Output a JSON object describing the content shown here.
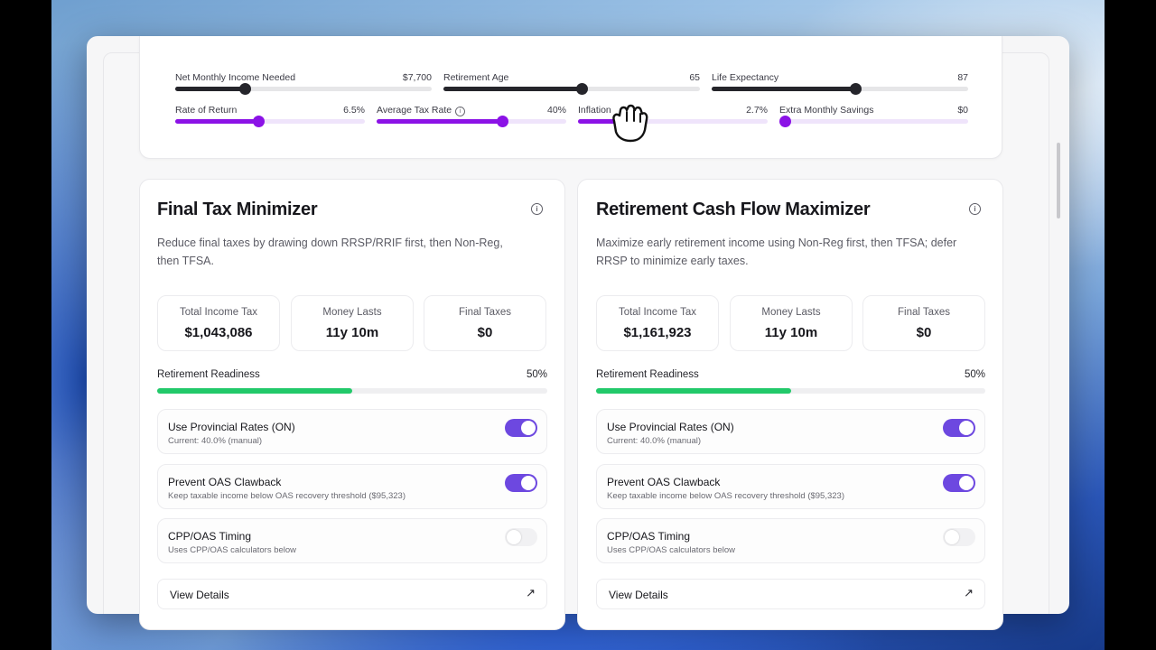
{
  "sliders": {
    "net_income": {
      "label": "Net Monthly Income Needed",
      "value": "$7,700",
      "fraction": 0.27
    },
    "retirement_age": {
      "label": "Retirement Age",
      "value": "65",
      "fraction": 0.54
    },
    "life_expectancy": {
      "label": "Life Expectancy",
      "value": "87",
      "fraction": 0.56
    },
    "rate_of_return": {
      "label": "Rate of Return",
      "value": "6.5%",
      "fraction": 0.44
    },
    "average_tax_rate": {
      "label": "Average Tax Rate",
      "value": "40%",
      "fraction": 0.66
    },
    "inflation": {
      "label": "Inflation",
      "value": "2.7%",
      "fraction": 0.27
    },
    "extra_savings": {
      "label": "Extra Monthly Savings",
      "value": "$0",
      "fraction": 0.0
    }
  },
  "cards": [
    {
      "title": "Final Tax Minimizer",
      "description": "Reduce final taxes by drawing down RRSP/RRIF first, then Non-Reg, then TFSA.",
      "stats": [
        {
          "label": "Total Income Tax",
          "value": "$1,043,086"
        },
        {
          "label": "Money Lasts",
          "value": "11y 10m"
        },
        {
          "label": "Final Taxes",
          "value": "$0"
        }
      ],
      "readiness": {
        "label": "Retirement Readiness",
        "value": "50%",
        "fraction": 0.5
      },
      "options": [
        {
          "title": "Use Provincial Rates (ON)",
          "subtitle": "Current: 40.0% (manual)",
          "on": true
        },
        {
          "title": "Prevent OAS Clawback",
          "subtitle": "Keep taxable income below OAS recovery threshold ($95,323)",
          "on": true
        },
        {
          "title": "CPP/OAS Timing",
          "subtitle": "Uses CPP/OAS calculators below",
          "on": false
        }
      ],
      "view_details": "View Details"
    },
    {
      "title": "Retirement Cash Flow Maximizer",
      "description": "Maximize early retirement income using Non-Reg first, then TFSA; defer RRSP to minimize early taxes.",
      "stats": [
        {
          "label": "Total Income Tax",
          "value": "$1,161,923"
        },
        {
          "label": "Money Lasts",
          "value": "11y 10m"
        },
        {
          "label": "Final Taxes",
          "value": "$0"
        }
      ],
      "readiness": {
        "label": "Retirement Readiness",
        "value": "50%",
        "fraction": 0.5
      },
      "options": [
        {
          "title": "Use Provincial Rates (ON)",
          "subtitle": "Current: 40.0% (manual)",
          "on": true
        },
        {
          "title": "Prevent OAS Clawback",
          "subtitle": "Keep taxable income below OAS recovery threshold ($95,323)",
          "on": true
        },
        {
          "title": "CPP/OAS Timing",
          "subtitle": "Uses CPP/OAS calculators below",
          "on": false
        }
      ],
      "view_details": "View Details"
    }
  ],
  "colors": {
    "accent_purple": "#8b12e6",
    "toggle_on": "#6d48e0",
    "readiness_green": "#22c96a",
    "slider_dark": "#25252b"
  },
  "icons": {
    "info": "info-icon",
    "arrow": "arrow-up-right-icon",
    "cursor": "grab-hand-cursor-icon"
  }
}
